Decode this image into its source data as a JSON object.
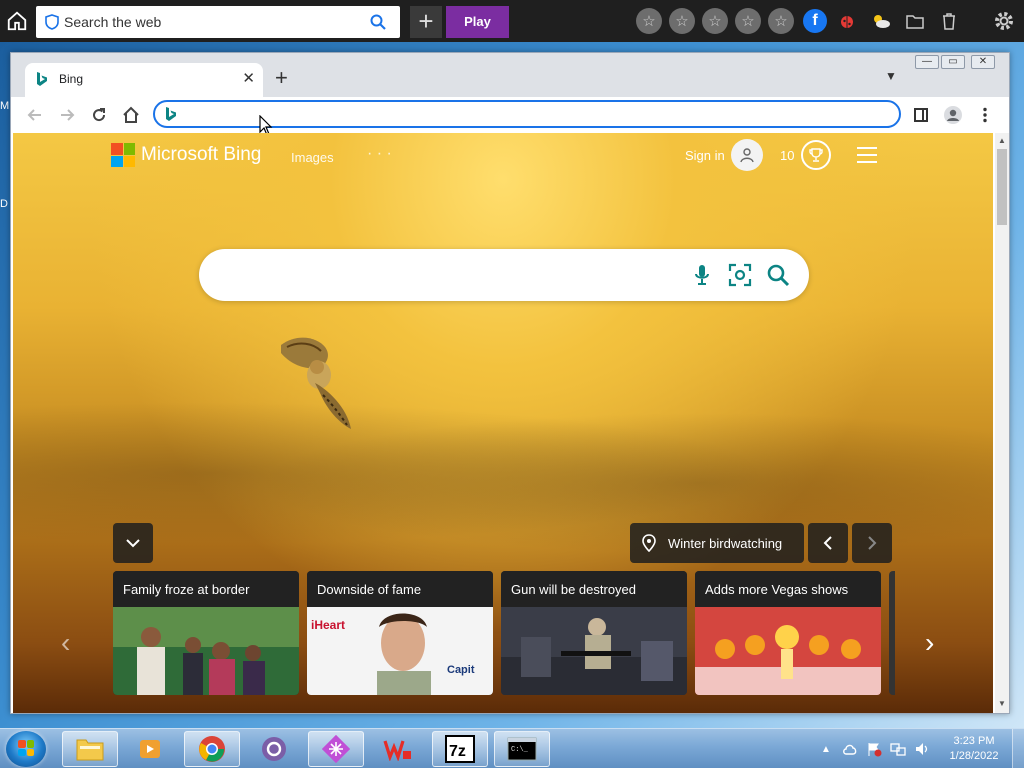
{
  "topbar": {
    "search_placeholder": "Search the web",
    "play_label": "Play"
  },
  "browser": {
    "tab_title": "Bing",
    "omnibox_value": ""
  },
  "bing": {
    "logo_text": "Microsoft Bing",
    "nav_images": "Images",
    "nav_more": "· · ·",
    "signin_label": "Sign in",
    "rewards_points": "10",
    "search_value": "",
    "image_info": "Winter birdwatching"
  },
  "news": [
    {
      "headline": "Family froze at border"
    },
    {
      "headline": "Downside of fame"
    },
    {
      "headline": "Gun will be destroyed"
    },
    {
      "headline": "Adds more Vegas shows"
    }
  ],
  "taskbar": {
    "time": "3:23 PM",
    "date": "1/28/2022"
  },
  "colors": {
    "accent": "#1a73e8",
    "play_purple": "#7b2da1",
    "facebook_blue": "#1877f2",
    "bing_teal": "#0c8484"
  },
  "icons": [
    "home-icon",
    "shield-icon",
    "search-icon",
    "plus-icon",
    "star-icon",
    "facebook-icon",
    "ladybug-icon",
    "weather-icon",
    "folder-icon",
    "trash-icon",
    "gear-icon",
    "microphone-icon",
    "visual-search-icon",
    "location-pin-icon",
    "trophy-icon",
    "user-icon",
    "hamburger-menu-icon",
    "chevron-down-icon",
    "chevron-left-icon",
    "chevron-right-icon"
  ]
}
